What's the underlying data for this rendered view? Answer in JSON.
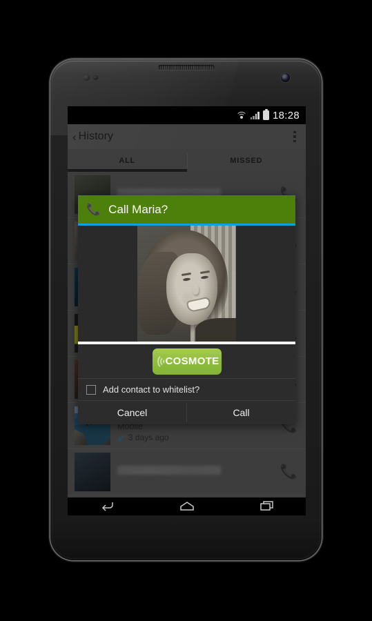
{
  "status_bar": {
    "time": "18:28",
    "icons": [
      "wifi-icon",
      "signal-icon",
      "battery-icon"
    ]
  },
  "action_bar": {
    "back_label": "‹",
    "title": "History",
    "overflow_label": ""
  },
  "tabs": [
    {
      "label": "ALL",
      "selected": true
    },
    {
      "label": "MISSED",
      "selected": false
    }
  ],
  "call_list": [
    {
      "name": "",
      "subtitle": "Mobile",
      "time": "3 days ago",
      "direction_icon": "incoming-call-arrow",
      "thumb": "cliff-jump-photo"
    }
  ],
  "dialog": {
    "header_icon": "phone-icon",
    "title": "Call Maria?",
    "photo_alt": "contact-portrait",
    "logo_text": "COSMOTE",
    "checkbox": {
      "label": "Add contact to whitelist?",
      "checked": false
    },
    "buttons": [
      {
        "label": "Cancel",
        "name": "cancel-button"
      },
      {
        "label": "Call",
        "name": "call-button"
      }
    ]
  },
  "nav_bar": {
    "back": "back-icon",
    "home": "home-icon",
    "recent": "recent-apps-icon"
  },
  "colors": {
    "dialog_header_green": "#4d800a",
    "dialog_accent_cyan": "#0aa3dd",
    "cosmote_green": "#8dbb3c",
    "incoming_arrow_blue": "#2a8fd8",
    "dialog_background": "#2c2c2c",
    "app_background": "#6a6a6a"
  }
}
